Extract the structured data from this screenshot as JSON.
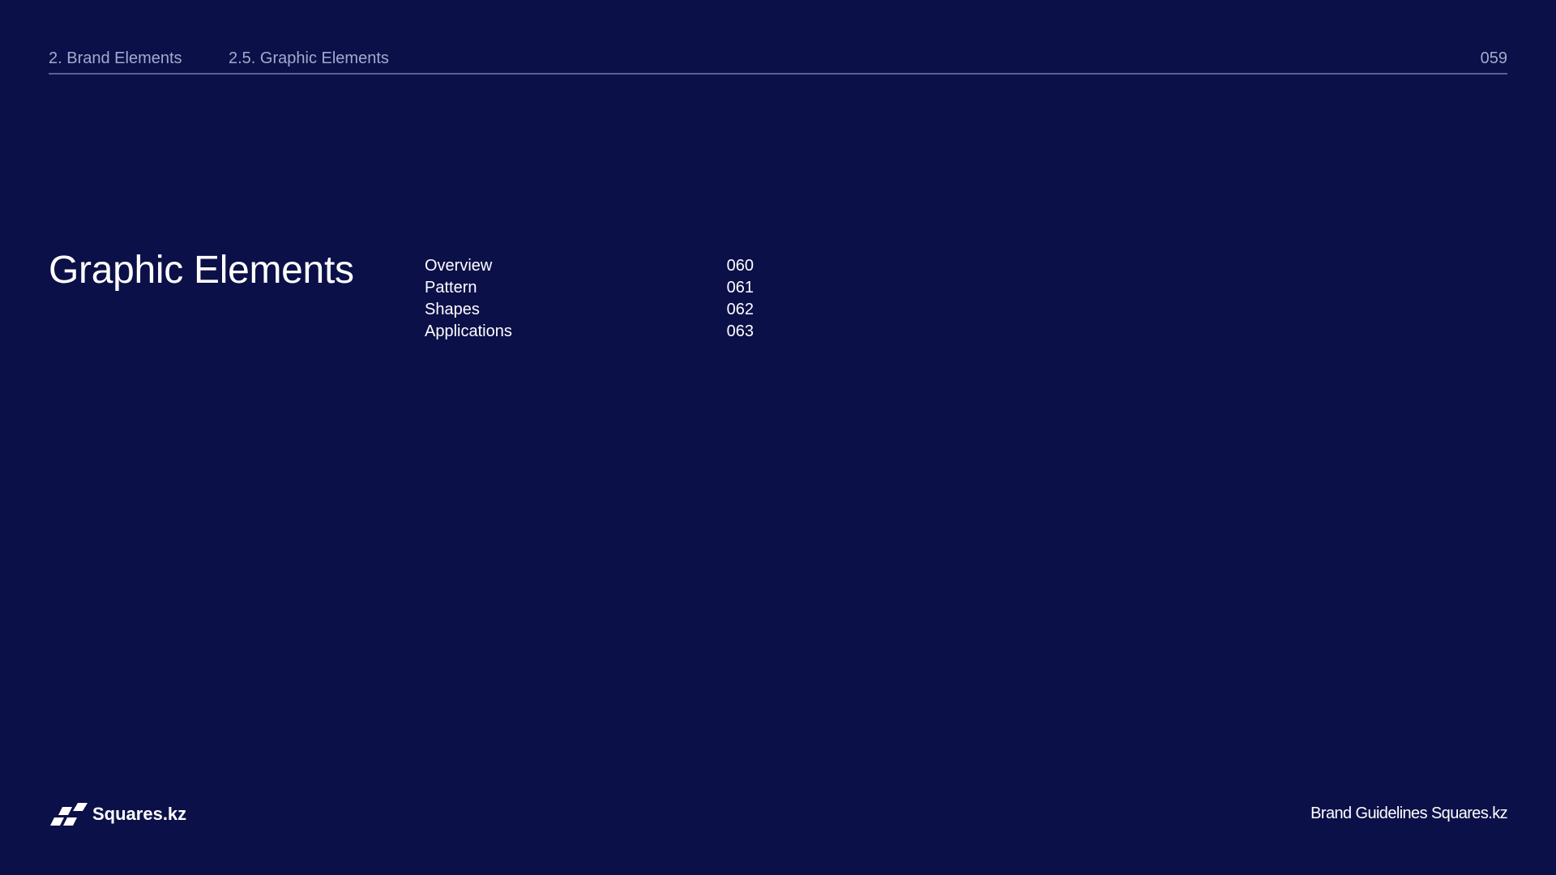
{
  "header": {
    "section": "2. Brand Elements",
    "subsection": "2.5. Graphic Elements",
    "page_number": "059"
  },
  "title": "Graphic Elements",
  "toc": [
    {
      "label": "Overview",
      "page": "060"
    },
    {
      "label": "Pattern",
      "page": "061"
    },
    {
      "label": "Shapes",
      "page": "062"
    },
    {
      "label": "Applications",
      "page": "063"
    }
  ],
  "footer": {
    "logo_icon": "squares-logo-icon",
    "brand": "Squares.kz",
    "text": "Brand Guidelines Squares.kz"
  },
  "colors": {
    "background": "#0b1048",
    "text": "#ffffff",
    "muted": "#a4a9cd",
    "rule": "#5a6197"
  }
}
